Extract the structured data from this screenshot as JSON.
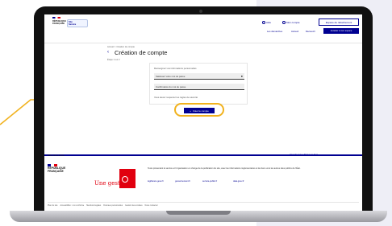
{
  "header": {
    "marianne_lines": "RÉPUBLIQUE\nFRANÇAISE",
    "brand_top": "Site",
    "brand_bottom": "Service",
    "tools": [
      "Aide",
      "Mon compte",
      "Espace de rattachement"
    ],
    "espace_label": "Espace de rattachement",
    "nav_items": [
      "Les démarches",
      "Accueil",
      "Découvrir"
    ],
    "nav_button": "Accéder à mon espace"
  },
  "breadcrumb": "Accueil  >  Création de compte",
  "page_title": "Création de compte",
  "step_label": "Étape 1 sur 2",
  "form": {
    "hint": "Renseignez vos informations personnelles",
    "password_placeholder": "Saisissez votre mot de passe",
    "confirm_placeholder": "Confirmation du mot de passe",
    "helper": "Vous devez respecter les règles de sécurité",
    "submit_label": "Créer le compte"
  },
  "footer": {
    "links_label": "Aide    Nous écrire",
    "top_link": "Haut de page / Retour en haut",
    "rf_lines": "RÉPUBLIQUE\nFRANÇAISE",
    "gov_text": "Une gestion",
    "description": "Texte présentant le service et l'organisation en charge de la publication du site, avec les informations réglementaires et les liens vers les autres sites publics de l'État.",
    "external_links": [
      "legifrance.gouv.fr",
      "gouvernement.fr",
      "service-public.fr",
      "data.gouv.fr"
    ],
    "bottom_links": [
      "Plan du site",
      "Accessibilité : non conforme",
      "Mentions légales",
      "Données personnelles",
      "Gestion des cookies",
      "Nous contacter"
    ]
  },
  "colors": {
    "primary": "#000091",
    "highlight": "#f1b21e",
    "marianne_red": "#e1000f"
  }
}
